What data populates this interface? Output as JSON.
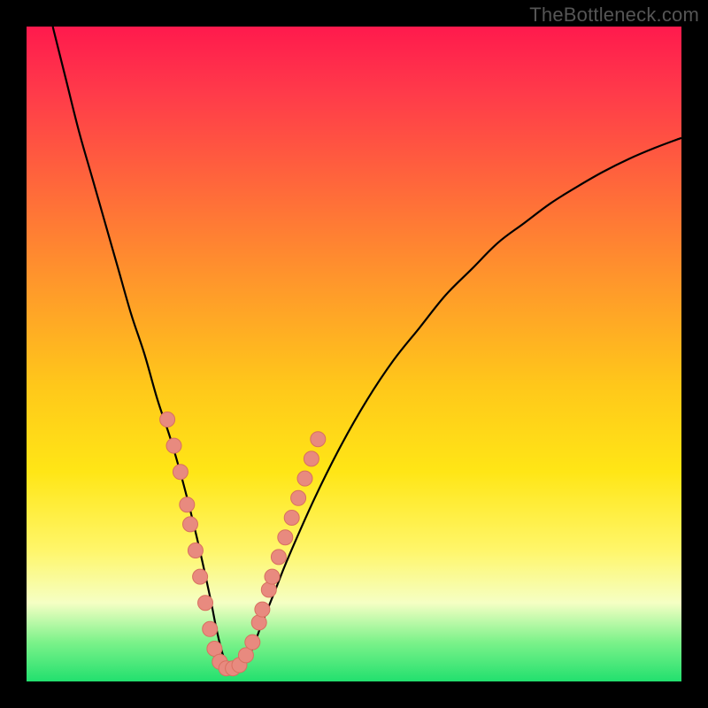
{
  "watermark": "TheBottleneck.com",
  "colors": {
    "frame": "#000000",
    "gradient_top": "#ff1a4d",
    "gradient_mid1": "#ff9a2a",
    "gradient_mid2": "#ffe616",
    "gradient_bottom": "#22e06e",
    "curve": "#000000",
    "dot_fill": "#e88a7f",
    "dot_stroke": "#d87060"
  },
  "chart_data": {
    "type": "line",
    "title": "",
    "xlabel": "",
    "ylabel": "",
    "xlim": [
      0,
      100
    ],
    "ylim": [
      0,
      100
    ],
    "grid": false,
    "legend": false,
    "series": [
      {
        "name": "bottleneck-curve",
        "x": [
          4,
          6,
          8,
          10,
          12,
          14,
          16,
          18,
          20,
          22,
          24,
          26,
          28,
          29,
          30,
          31,
          32,
          34,
          36,
          38,
          40,
          44,
          48,
          52,
          56,
          60,
          64,
          68,
          72,
          76,
          80,
          84,
          88,
          92,
          96,
          100
        ],
        "y": [
          100,
          92,
          84,
          77,
          70,
          63,
          56,
          50,
          43,
          37,
          30,
          22,
          13,
          8,
          4,
          2,
          2,
          4,
          9,
          14,
          19,
          28,
          36,
          43,
          49,
          54,
          59,
          63,
          67,
          70,
          73,
          75.5,
          77.8,
          79.8,
          81.5,
          83
        ]
      }
    ],
    "marker_clusters": [
      {
        "name": "left-arm-dots",
        "points": [
          {
            "x": 21.5,
            "y": 40
          },
          {
            "x": 22.5,
            "y": 36
          },
          {
            "x": 23.5,
            "y": 32
          },
          {
            "x": 24.5,
            "y": 27
          },
          {
            "x": 25.0,
            "y": 24
          },
          {
            "x": 25.8,
            "y": 20
          },
          {
            "x": 26.5,
            "y": 16
          },
          {
            "x": 27.3,
            "y": 12
          },
          {
            "x": 28.0,
            "y": 8
          },
          {
            "x": 28.7,
            "y": 5
          }
        ]
      },
      {
        "name": "trough-dots",
        "points": [
          {
            "x": 29.5,
            "y": 3
          },
          {
            "x": 30.5,
            "y": 2
          },
          {
            "x": 31.5,
            "y": 2
          },
          {
            "x": 32.5,
            "y": 2.5
          }
        ]
      },
      {
        "name": "right-arm-dots",
        "points": [
          {
            "x": 33.5,
            "y": 4
          },
          {
            "x": 34.5,
            "y": 6
          },
          {
            "x": 35.5,
            "y": 9
          },
          {
            "x": 36.0,
            "y": 11
          },
          {
            "x": 37.0,
            "y": 14
          },
          {
            "x": 37.5,
            "y": 16
          },
          {
            "x": 38.5,
            "y": 19
          },
          {
            "x": 39.5,
            "y": 22
          },
          {
            "x": 40.5,
            "y": 25
          },
          {
            "x": 41.5,
            "y": 28
          },
          {
            "x": 42.5,
            "y": 31
          },
          {
            "x": 43.5,
            "y": 34
          },
          {
            "x": 44.5,
            "y": 37
          }
        ]
      }
    ]
  }
}
